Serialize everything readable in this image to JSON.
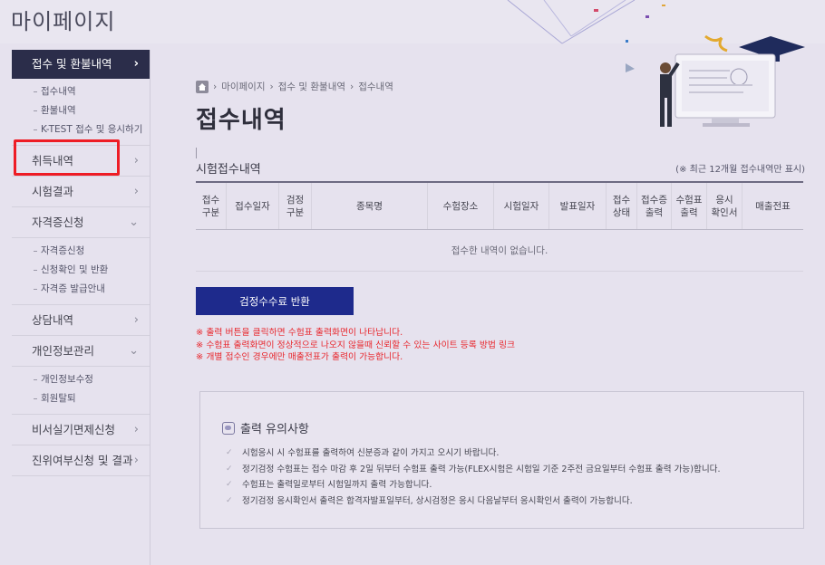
{
  "header": {
    "title": "마이페이지"
  },
  "sidebar": {
    "groups": [
      {
        "label": "접수 및 환불내역",
        "items": [
          "접수내역",
          "환불내역",
          "K-TEST 접수 및 응시하기"
        ]
      },
      {
        "label": "취득내역"
      },
      {
        "label": "시험결과"
      },
      {
        "label": "자격증신청",
        "items": [
          "자격증신청",
          "신청확인 및 반환",
          "자격증 발급안내"
        ]
      },
      {
        "label": "상담내역"
      },
      {
        "label": "개인정보관리",
        "items": [
          "개인정보수정",
          "회원탈퇴"
        ]
      },
      {
        "label": "비서실기면제신청"
      },
      {
        "label": "진위여부신청 및 결과"
      }
    ]
  },
  "breadcrumb": {
    "items": [
      "마이페이지",
      "접수 및 환불내역",
      "접수내역"
    ]
  },
  "main": {
    "title": "접수내역",
    "section_title": "시험접수내역",
    "section_note": "(※ 최근 12개월 접수내역만 표시)",
    "table": {
      "headers": [
        "접수\n구분",
        "접수일자",
        "검정\n구분",
        "종목명",
        "수험장소",
        "시험일자",
        "발표일자",
        "접수\n상태",
        "접수증\n출력",
        "수험표\n출력",
        "응시\n확인서",
        "매출전표"
      ],
      "empty_message": "접수한 내역이 없습니다."
    },
    "refund_button": "검정수수료 반환",
    "notes": [
      "※ 출력 버튼을 클릭하면 수험표 출력화면이 나타납니다.",
      "※ 수험표 출력화면이 정상적으로 나오지 않을때 신뢰할 수 있는 사이트 등록 방법 링크",
      "※ 개별 접수인 경우에만 매출전표가 출력이 가능합니다."
    ]
  },
  "caution": {
    "title": "출력 유의사항",
    "items": [
      "시험응시 시 수험표를 출력하여 신분증과 같이 가지고 오시기 바랍니다.",
      "정기검정 수험표는 접수 마감 후 2일 뒤부터 수험표 출력 가능(FLEX시험은 시험일 기준 2주전 금요일부터 수험표 출력 가능)합니다.",
      "수험표는 출력일로부터 시험일까지 출력 가능합니다.",
      "정기검정 응시확인서 출력은 합격자발표일부터, 상시검정은 응시 다음날부터 응시확인서 출력이 가능합니다."
    ]
  },
  "colors": {
    "active_nav": "#2b2d4a",
    "primary_button": "#1e2a8c",
    "notice_red": "#e8262c",
    "highlight": "#ee1c25"
  },
  "icons": [
    "home-icon",
    "chevron-right-icon",
    "chevron-down-icon",
    "caution-icon",
    "check-icon"
  ]
}
